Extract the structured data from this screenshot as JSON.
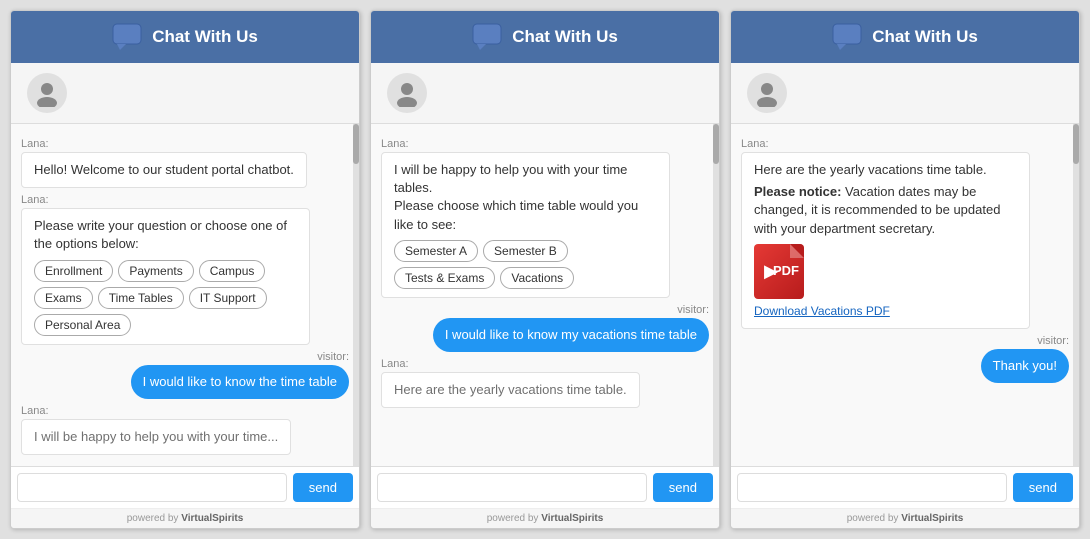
{
  "panels": [
    {
      "id": "panel1",
      "header": {
        "title": "Chat With Us",
        "icon": "💬"
      },
      "messages": [
        {
          "sender": "lana",
          "text": "Hello! Welcome to our student portal chatbot."
        },
        {
          "sender": "lana",
          "type": "options",
          "text": "Please write your question or choose one of the options below:",
          "options": [
            "Enrollment",
            "Payments",
            "Campus",
            "Exams",
            "Time Tables",
            "IT Support",
            "Personal Area"
          ]
        },
        {
          "sender": "visitor",
          "text": "I would like to know the time table"
        },
        {
          "sender": "lana",
          "partial": true,
          "text": "I will be happy to help you with your time..."
        }
      ],
      "input_placeholder": "",
      "send_label": "send",
      "powered_by": "powered by VirtualSpirits"
    },
    {
      "id": "panel2",
      "header": {
        "title": "Chat With Us",
        "icon": "💬"
      },
      "messages": [
        {
          "sender": "lana",
          "type": "options",
          "text": "I will be happy to help you with your time tables.\n\nPlease choose which time table would you like to see:",
          "options": [
            "Semester A",
            "Semester B",
            "Tests & Exams",
            "Vacations"
          ]
        },
        {
          "sender": "visitor",
          "text": "I would like to know my vacations time table"
        },
        {
          "sender": "lana",
          "partial": true,
          "text": "Here are the yearly vacations time table."
        }
      ],
      "input_placeholder": "",
      "send_label": "send",
      "powered_by": "powered by VirtualSpirits"
    },
    {
      "id": "panel3",
      "header": {
        "title": "Chat With Us",
        "icon": "💬"
      },
      "messages": [
        {
          "sender": "lana",
          "type": "pdf",
          "text": "Here are the yearly vacations time table.",
          "notice": "Please notice:",
          "notice_text": " Vacation dates may be changed, it is recommended to be updated with your department secretary.",
          "pdf_label": "Download Vacations PDF"
        },
        {
          "sender": "visitor",
          "text": "Thank you!"
        }
      ],
      "input_placeholder": "",
      "send_label": "send",
      "powered_by": "powered by VirtualSpirits"
    }
  ]
}
